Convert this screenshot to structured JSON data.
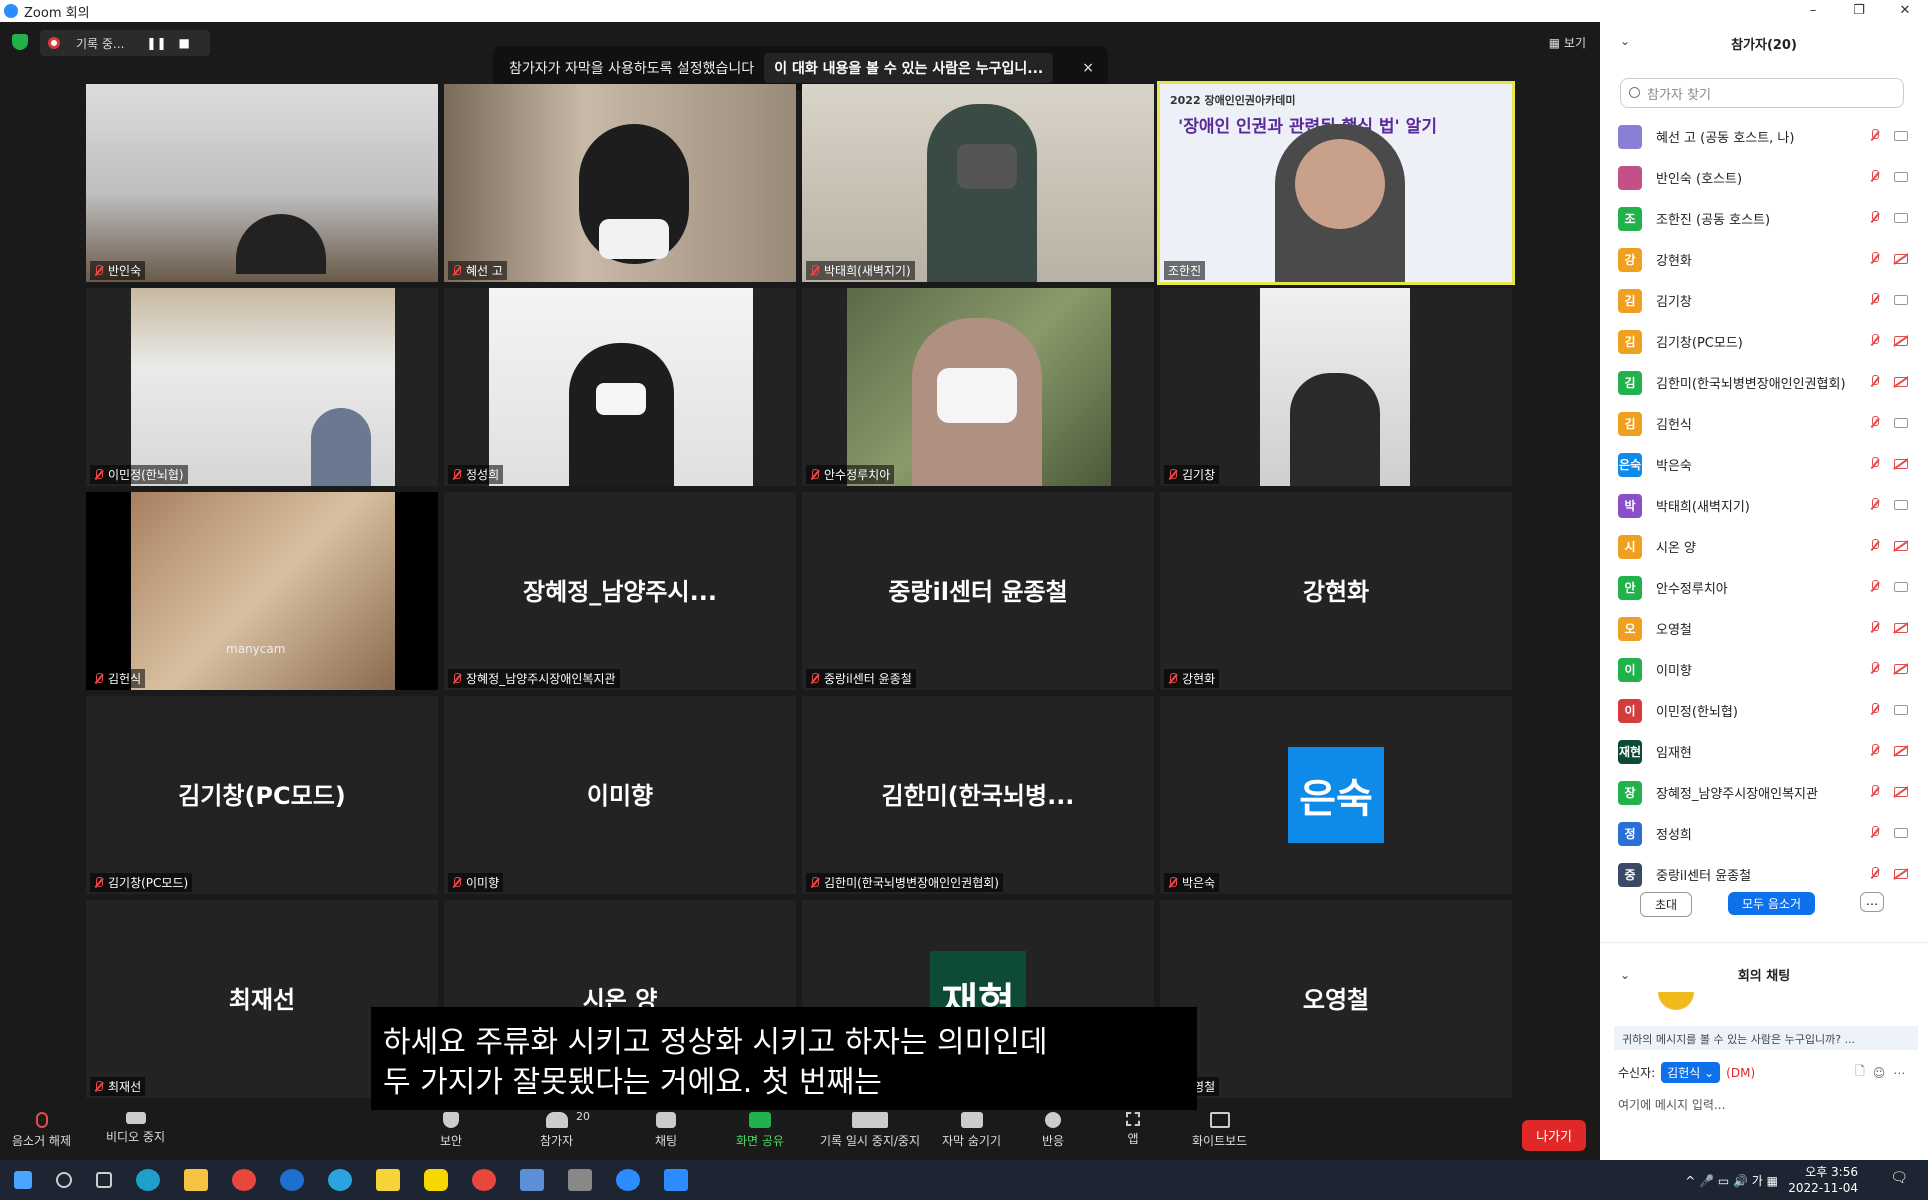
{
  "window": {
    "title": "Zoom 회의",
    "controls": [
      "–",
      "❐",
      "✕"
    ]
  },
  "top": {
    "recording_label": "기록 중...",
    "view_label": "보기",
    "caption_notice": "참가자가 자막을 사용하도록 설정했습니다",
    "caption_who": "이 대화 내용을 볼 수 있는 사람은 누구입니...",
    "caption_close": "×"
  },
  "tiles": [
    {
      "name": "반인숙"
    },
    {
      "name": "혜선 고"
    },
    {
      "name": "박태희(새벽지기)"
    },
    {
      "name": "조한진",
      "banner_year": "2022 장애인인권아카데미",
      "banner_text": "'장애인 인권과 관련된 핵심 법' 알기"
    },
    {
      "name": "이민정(한뇌협)"
    },
    {
      "name": "정성희"
    },
    {
      "name": "안수정루치아"
    },
    {
      "name": "김기창"
    },
    {
      "name": "김헌식",
      "watermark": "manycam"
    },
    {
      "name": "장혜정_남양주시장애인복지관",
      "big": "장혜정_남양주시..."
    },
    {
      "name": "중랑il센터 윤종철",
      "big": "중랑il센터 윤종철"
    },
    {
      "name": "강현화",
      "big": "강현화"
    },
    {
      "name": "김기창(PC모드)",
      "big": "김기창(PC모드)"
    },
    {
      "name": "이미향",
      "big": "이미향"
    },
    {
      "name": "김한미(한국뇌병변장애인인권협회)",
      "big": "김한미(한국뇌병..."
    },
    {
      "name": "박은숙",
      "avatar": "은숙"
    },
    {
      "name": "최재선",
      "big": "최재선"
    },
    {
      "name": "",
      "big": "시온 양"
    },
    {
      "name": "",
      "avatar": "재현"
    },
    {
      "name": "오영철",
      "big": "오영철"
    }
  ],
  "subtitle": {
    "line1": "하세요 주류화 시키고 정상화 시키고 하자는 의미인데",
    "line2": "두 가지가 잘못됐다는 거에요. 첫 번째는"
  },
  "toolbar": {
    "unmute": "음소거 해제",
    "video": "비디오 중지",
    "security": "보안",
    "participants": "참가자",
    "participants_count": "20",
    "chat": "채팅",
    "share": "화면 공유",
    "record": "기록 일시 중지/중지",
    "captions": "자막 숨기기",
    "reactions": "반응",
    "apps": "앱",
    "whiteboard": "화이트보드",
    "leave": "나가기"
  },
  "panel": {
    "title": "참가자(20)",
    "search_placeholder": "참가자 찾기",
    "participants": [
      {
        "name": "혜선 고 (공동 호스트, 나)",
        "initial": "",
        "color": "#8a7fd6",
        "cam_off": false
      },
      {
        "name": "반인숙 (호스트)",
        "initial": "",
        "color": "#c4508a",
        "cam_off": false
      },
      {
        "name": "조한진 (공동 호스트)",
        "initial": "조",
        "color": "#22b24c",
        "cam_off": false
      },
      {
        "name": "강현화",
        "initial": "강",
        "color": "#f0a020",
        "cam_off": true
      },
      {
        "name": "김기창",
        "initial": "김",
        "color": "#f0a020",
        "cam_off": false
      },
      {
        "name": "김기창(PC모드)",
        "initial": "김",
        "color": "#f0a020",
        "cam_off": true
      },
      {
        "name": "김한미(한국뇌병변장애인인권협회)",
        "initial": "김",
        "color": "#22b24c",
        "cam_off": true
      },
      {
        "name": "김헌식",
        "initial": "김",
        "color": "#f0a020",
        "cam_off": false
      },
      {
        "name": "박은숙",
        "initial": "은숙",
        "color": "#0e8ae8",
        "cam_off": true
      },
      {
        "name": "박태희(새벽지기)",
        "initial": "박",
        "color": "#8a4fc8",
        "cam_off": false
      },
      {
        "name": "시온 양",
        "initial": "시",
        "color": "#f0a020",
        "cam_off": true
      },
      {
        "name": "안수정루치아",
        "initial": "안",
        "color": "#22b24c",
        "cam_off": false
      },
      {
        "name": "오영철",
        "initial": "오",
        "color": "#f0a020",
        "cam_off": true
      },
      {
        "name": "이미향",
        "initial": "이",
        "color": "#22b24c",
        "cam_off": true
      },
      {
        "name": "이민정(한뇌협)",
        "initial": "이",
        "color": "#d43b3b",
        "cam_off": false
      },
      {
        "name": "임재현",
        "initial": "재현",
        "color": "#0d4a38",
        "cam_off": true
      },
      {
        "name": "장혜정_남양주시장애인복지관",
        "initial": "장",
        "color": "#22b24c",
        "cam_off": true
      },
      {
        "name": "정성희",
        "initial": "정",
        "color": "#2a6fd6",
        "cam_off": false
      },
      {
        "name": "중랑il센터 윤종철",
        "initial": "중",
        "color": "#3a4a66",
        "cam_off": true
      }
    ],
    "invite": "초대",
    "mute_all": "모두 음소거",
    "more": "…",
    "chat_title": "회의 채팅",
    "chat_notice": "귀하의 메시지를 볼 수 있는 사람은 누구입니까? ...",
    "recipient_label": "수신자:",
    "recipient": "김헌식",
    "dm": "(DM)",
    "chat_placeholder": "여기에 메시지 입력..."
  },
  "taskbar": {
    "time": "오후 3:56",
    "date": "2022-11-04",
    "ime": "가"
  }
}
